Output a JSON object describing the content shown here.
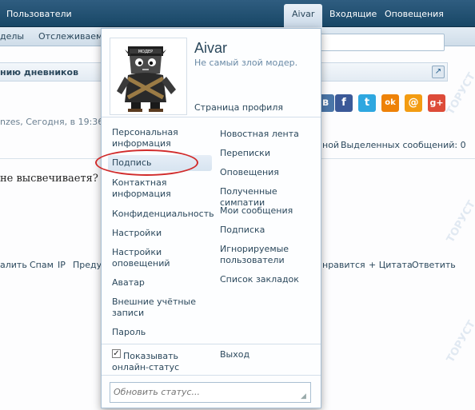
{
  "navbar": {
    "users": "Пользователи",
    "username": "Aivar",
    "inbox": "Входящие",
    "alerts": "Оповещения"
  },
  "subnav": {
    "sections": "делы",
    "watched": "Отслеживаемы"
  },
  "breadcrumb": "нию дневников",
  "post": {
    "meta": "nzes, Сегодня, в 19:36.",
    "selected": "Выделенных сообщений: 0",
    "frag1": "ной",
    "text": "не высвечиваетя?",
    "actions": {
      "delete": "алить",
      "spam": "Спам",
      "ip": "IP",
      "warn": "Предупр",
      "like": "нравится",
      "quote": "+ Цитата",
      "reply": "Ответить"
    }
  },
  "social": {
    "facebook": "f",
    "twitter": "t",
    "odnoklassniki": "ok",
    "mailru": "@",
    "googleplus": "g+",
    "vk": "в"
  },
  "watermark": "ТОРУСТ",
  "popup": {
    "username": "Aivar",
    "title": "Не самый злой модер.",
    "profile_link": "Страница профиля",
    "avatar_caption": "МОДЕР",
    "left_menu": [
      "Персональная информация",
      "Подпись",
      "Контактная информация",
      "Конфиденциальность",
      "Настройки",
      "Настройки оповещений",
      "Аватар",
      "Внешние учётные записи",
      "Пароль"
    ],
    "right_menu": [
      "Новостная лента",
      "Переписки",
      "Оповещения",
      "Полученные симпатии",
      "Мои сообщения",
      "Подписка",
      "Игнорируемые пользователи",
      "Список закладок"
    ],
    "show_online": "Показывать онлайн-статус",
    "logout": "Выход",
    "status_placeholder": "Обновить статус..."
  },
  "colors": {
    "navbar": "#184766",
    "link": "#2b485c",
    "highlight_oval": "#d12b2b"
  }
}
